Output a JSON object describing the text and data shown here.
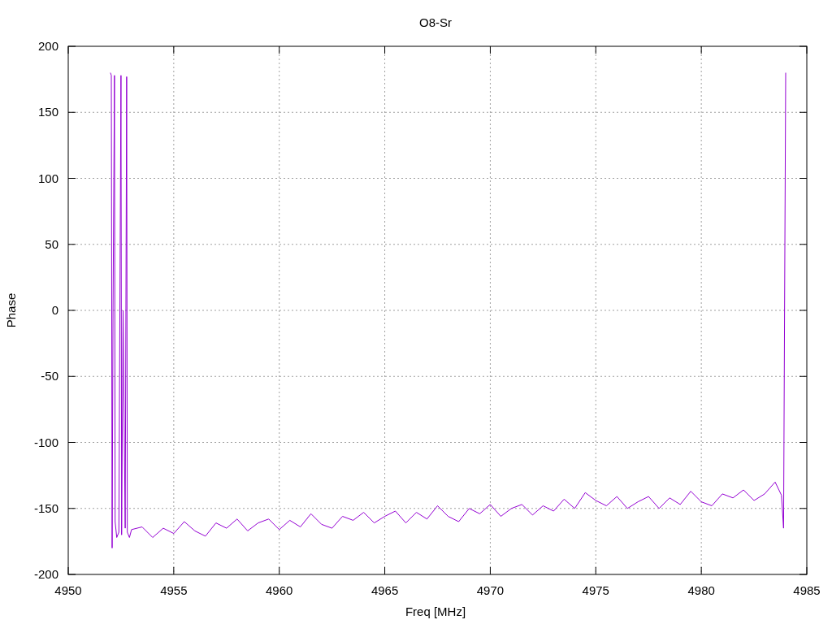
{
  "chart_data": {
    "type": "line",
    "grid": true,
    "title": "O8-Sr",
    "xlabel": "Freq [MHz]",
    "ylabel": "Phase",
    "xlim": [
      4950,
      4985
    ],
    "ylim": [
      -200,
      200
    ],
    "xticks": [
      4950,
      4955,
      4960,
      4965,
      4970,
      4975,
      4980,
      4985
    ],
    "yticks": [
      -200,
      -150,
      -100,
      -50,
      0,
      50,
      100,
      150,
      200
    ],
    "x": [
      4952,
      4952.04,
      4952.08,
      4952.12,
      4952.19,
      4952.22,
      4952.3,
      4952.4,
      4952.5,
      4952.53,
      4952.6,
      4952.7,
      4952.77,
      4952.8,
      4952.9,
      4953,
      4953.5,
      4954,
      4954.5,
      4955,
      4955.5,
      4956,
      4956.5,
      4957,
      4957.5,
      4958,
      4958.5,
      4959,
      4959.5,
      4960,
      4960.5,
      4961,
      4961.5,
      4962,
      4962.5,
      4963,
      4963.5,
      4964,
      4964.5,
      4965,
      4965.5,
      4966,
      4966.5,
      4967,
      4967.5,
      4968,
      4968.5,
      4969,
      4969.5,
      4970,
      4970.5,
      4971,
      4971.5,
      4972,
      4972.5,
      4973,
      4973.5,
      4974,
      4974.5,
      4975,
      4975.5,
      4976,
      4976.5,
      4977,
      4977.5,
      4978,
      4978.5,
      4979,
      4979.5,
      4980,
      4980.5,
      4981,
      4981.5,
      4982,
      4982.5,
      4983,
      4983.5,
      4983.8,
      4983.9,
      4983.95,
      4984
    ],
    "series": [
      {
        "color": "#9400d3",
        "values": [
          180,
          178,
          -180,
          0,
          178,
          -160,
          -172,
          -168,
          178,
          -170,
          0,
          -165,
          177,
          -168,
          -172,
          -166,
          -164,
          -172,
          -165,
          -169,
          -160,
          -167,
          -171,
          -161,
          -165,
          -158,
          -167,
          -161,
          -158,
          -166,
          -159,
          -164,
          -154,
          -162,
          -165,
          -156,
          -159,
          -153,
          -161,
          -156,
          -152,
          -161,
          -153,
          -158,
          -148,
          -156,
          -160,
          -150,
          -154,
          -147,
          -156,
          -150,
          -147,
          -155,
          -148,
          -152,
          -143,
          -150,
          -138,
          -144,
          -148,
          -141,
          -150,
          -145,
          -141,
          -150,
          -142,
          -147,
          -137,
          -145,
          -148,
          -139,
          -142,
          -136,
          -144,
          -139,
          -130,
          -140,
          -165,
          8,
          180
        ]
      }
    ]
  }
}
